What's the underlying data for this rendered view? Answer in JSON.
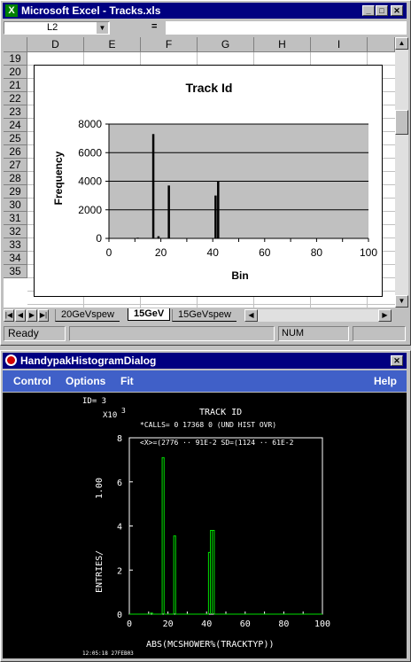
{
  "excel": {
    "title": "Microsoft Excel - Tracks.xls",
    "name_box": "L2",
    "formula_eq": "=",
    "columns": [
      "D",
      "E",
      "F",
      "G",
      "H",
      "I"
    ],
    "rows": [
      "19",
      "20",
      "21",
      "22",
      "23",
      "24",
      "25",
      "26",
      "27",
      "28",
      "29",
      "30",
      "31",
      "32",
      "33",
      "34",
      "35"
    ],
    "sheet_tabs": [
      "20GeVspew",
      "15GeV",
      "15GeVspew"
    ],
    "active_tab": "15GeV",
    "status_left": "Ready",
    "status_num": "NUM",
    "chart_title": "Track Id",
    "chart_xlabel": "Bin",
    "chart_ylabel": "Frequency",
    "y_ticks": [
      "8000",
      "6000",
      "4000",
      "2000",
      "0"
    ],
    "x_ticks": [
      "0",
      "20",
      "40",
      "60",
      "80",
      "100"
    ]
  },
  "hpk": {
    "title": "HandypakHistogramDialog",
    "menu": [
      "Control",
      "Options",
      "Fit"
    ],
    "help": "Help",
    "id_line": "ID=    3",
    "x10": "X10",
    "exp": "3",
    "hist_title": "TRACK ID",
    "calls_line": "*CALLS= 0  17368  0   (UND HIST OVR)",
    "stats_line": "<X>=(2776 ··  91E-2    SD=(1124 ··  61E-2",
    "scale_label": "1.00",
    "ylabel": "ENTRIES/",
    "xlabel": "ABS(MCSHOWER%(TRACKTYP))",
    "y_ticks": [
      "8",
      "6",
      "4",
      "2",
      "0"
    ],
    "x_ticks": [
      "0",
      "20",
      "40",
      "60",
      "80",
      "100"
    ],
    "timestamp": "12:05:18  27FEB03"
  },
  "colors": {
    "title_bar": "#000080",
    "chart_plot": "#c0c0c0",
    "histo_line": "#00e000"
  },
  "chart_data": [
    {
      "type": "bar",
      "title": "Track Id",
      "xlabel": "Bin",
      "ylabel": "Frequency",
      "xlim": [
        0,
        100
      ],
      "ylim": [
        0,
        8000
      ],
      "grid": true,
      "x": [
        11,
        17,
        19,
        23,
        41,
        42
      ],
      "values": [
        50,
        7300,
        150,
        3700,
        3000,
        4000
      ]
    },
    {
      "type": "line",
      "title": "TRACK ID",
      "xlabel": "ABS(MCSHOWER%(TRACKTYP))",
      "ylabel": "ENTRIES/",
      "xlim": [
        0,
        100
      ],
      "ylim": [
        0,
        8
      ],
      "x": [
        11,
        17,
        18,
        19,
        22,
        23,
        24,
        40,
        41,
        42,
        43,
        44
      ],
      "values": [
        0.05,
        7.1,
        0,
        0,
        0,
        3.55,
        0,
        0,
        2.8,
        3.8,
        3.8,
        0
      ]
    }
  ]
}
